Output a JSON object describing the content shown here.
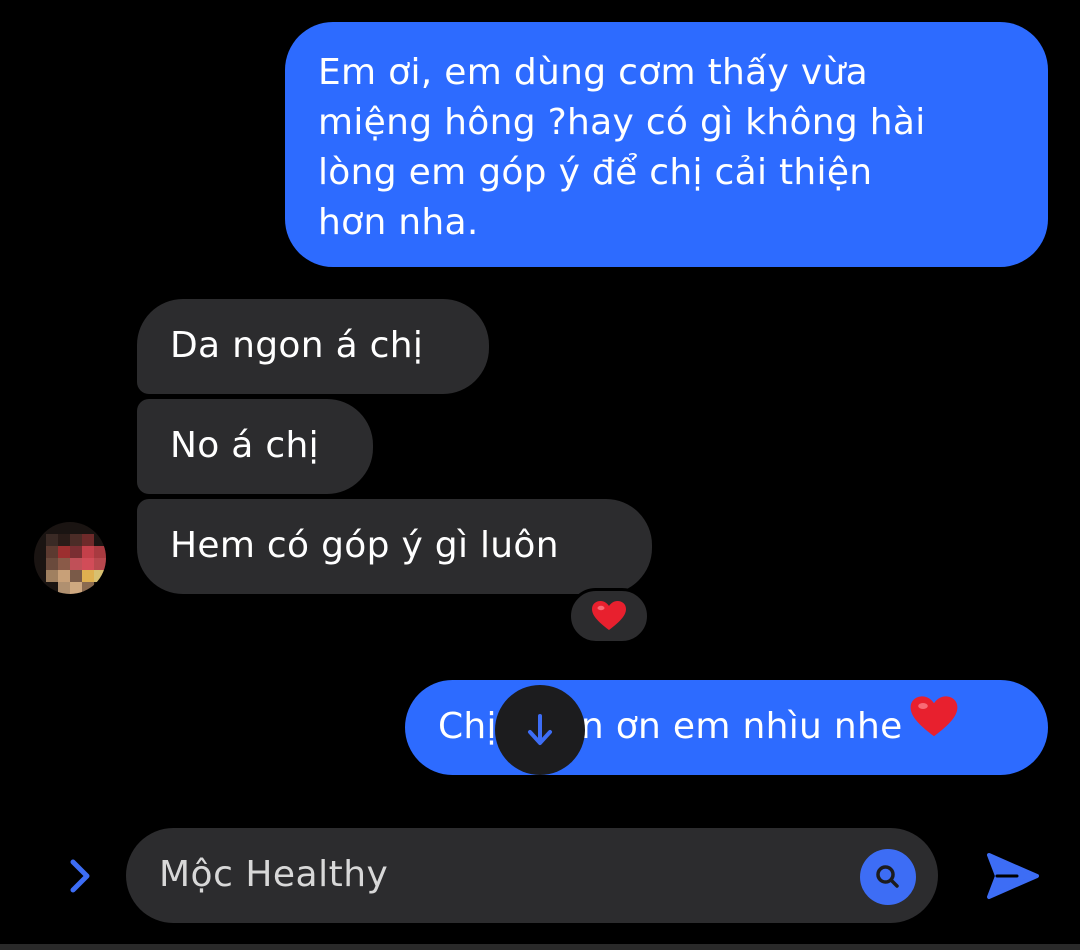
{
  "conversation": {
    "messages": [
      {
        "direction": "outgoing",
        "text": "Em ơi, em dùng cơm thấy vừa\nmiệng hông ?hay có gì không hài\nlòng em góp ý để chị cải thiện\nhơn nha."
      },
      {
        "direction": "incoming",
        "text": "Da ngon á chị"
      },
      {
        "direction": "incoming",
        "text": "No á chị"
      },
      {
        "direction": "incoming",
        "text": "Hem có góp ý gì luôn",
        "reaction": "heart"
      },
      {
        "direction": "outgoing",
        "text_visible_left": "Chị",
        "text_visible_right": "n ơn em nhìu nhe",
        "trailing_emoji": "heart"
      }
    ]
  },
  "composer": {
    "text": "Mộc Healthy",
    "search_icon": "search-icon",
    "send_icon": "send-icon",
    "expand_icon": "chevron-right-icon"
  },
  "overlay": {
    "scroll_down_icon": "arrow-down-icon"
  },
  "colors": {
    "background": "#000000",
    "outgoing_bubble": "#2d6bff",
    "incoming_bubble": "#2c2c2e",
    "accent": "#3d6df5",
    "heart": "#e8202e"
  }
}
